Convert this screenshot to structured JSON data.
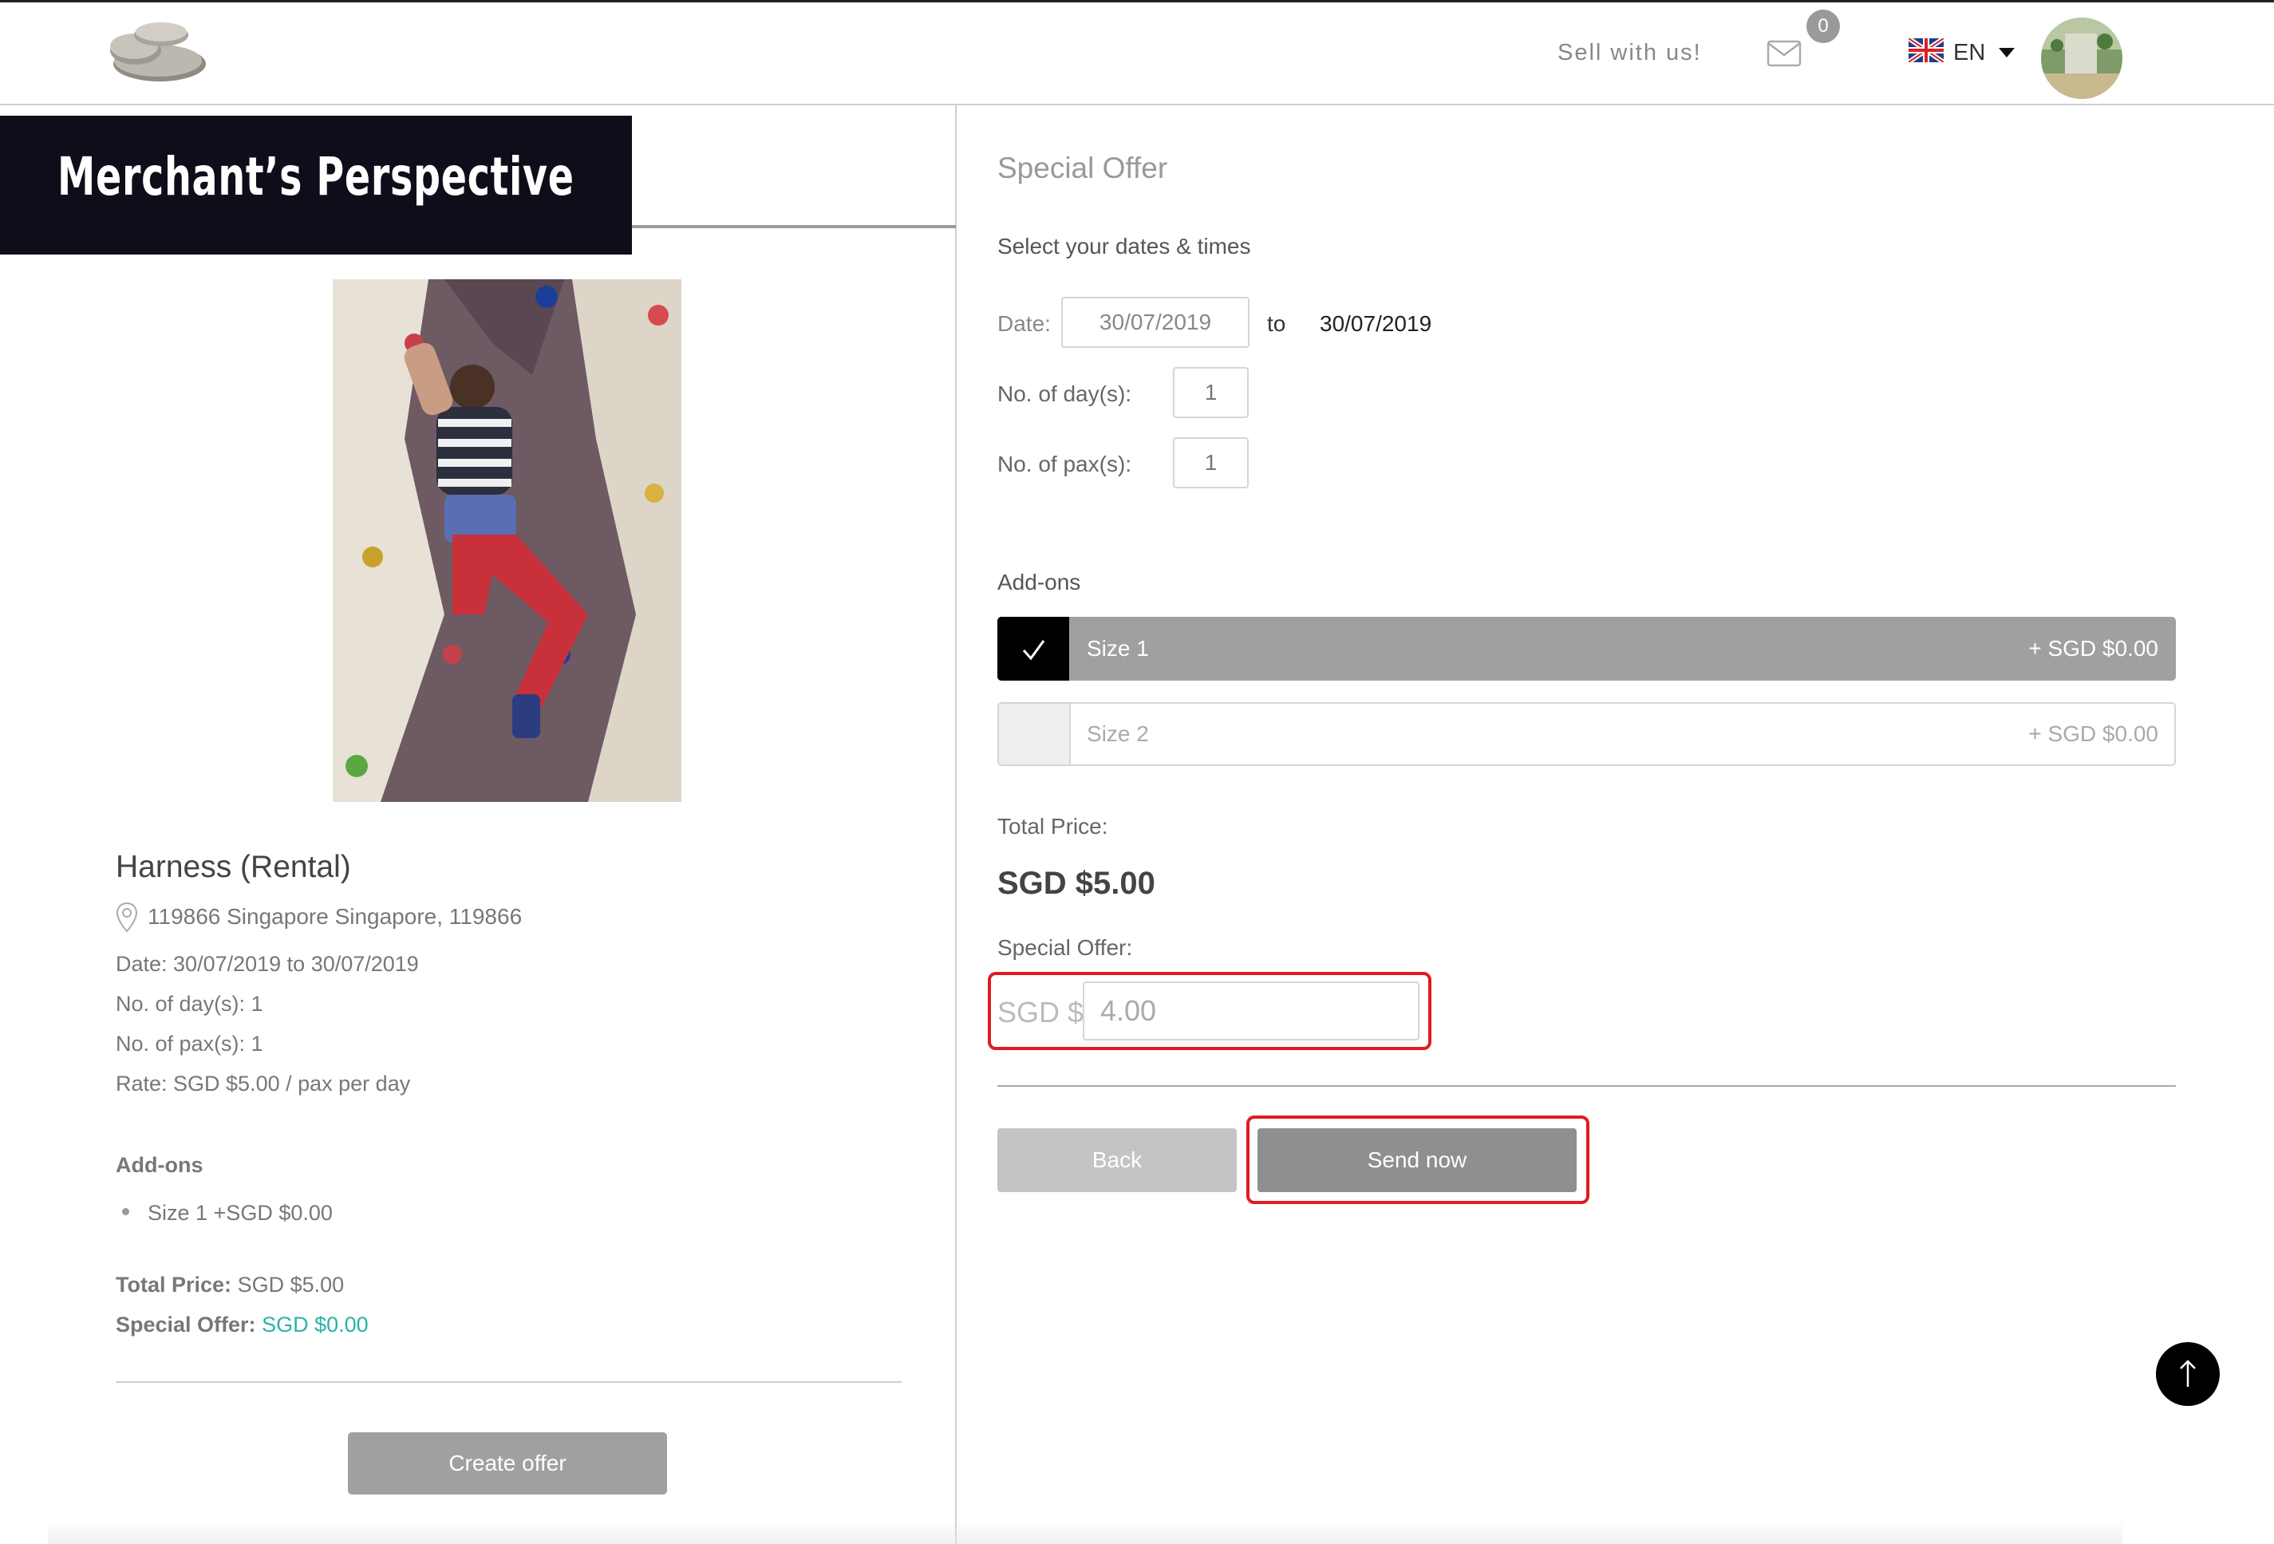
{
  "header": {
    "sell_link": "Sell with us!",
    "mail_badge": "0",
    "language": "EN"
  },
  "banner": {
    "text": "Merchant’s Perspective"
  },
  "product": {
    "title": "Harness (Rental)",
    "address": "119866 Singapore Singapore, 119866",
    "date": "Date: 30/07/2019 to 30/07/2019",
    "days": "No. of day(s): 1",
    "pax": "No. of pax(s): 1",
    "rate": "Rate: SGD $5.00 / pax per day",
    "addons_heading": "Add-ons",
    "addons": [
      "Size 1 +SGD $0.00"
    ],
    "total_label": "Total Price:",
    "total_value": "SGD $5.00",
    "special_label": "Special Offer:",
    "special_value": "SGD $0.00",
    "create_offer_label": "Create offer"
  },
  "offer_form": {
    "title": "Special Offer",
    "select_heading": "Select your dates & times",
    "date_label": "Date:",
    "date_from": "30/07/2019",
    "to_label": "to",
    "date_to": "30/07/2019",
    "days_label": "No. of day(s):",
    "days_value": "1",
    "pax_label": "No. of pax(s):",
    "pax_value": "1",
    "addons_heading": "Add-ons",
    "addons": [
      {
        "name": "Size 1",
        "price": "+ SGD $0.00",
        "checked": true
      },
      {
        "name": "Size 2",
        "price": "+ SGD $0.00",
        "checked": false
      }
    ],
    "total_label": "Total Price:",
    "total_value": "SGD $5.00",
    "special_label": "Special Offer:",
    "currency_prefix": "SGD $",
    "special_value": "4.00",
    "back_label": "Back",
    "send_label": "Send now"
  },
  "colors": {
    "highlight": "#e01b24",
    "banner_bg": "#0d0e1a",
    "teal": "#29b3a6",
    "button_gray": "#a0a0a0"
  },
  "icons": [
    "logo-rocks-icon",
    "mail-icon",
    "uk-flag-icon",
    "caret-down-icon",
    "map-pin-icon",
    "checkmark-icon",
    "arrow-up-icon"
  ]
}
